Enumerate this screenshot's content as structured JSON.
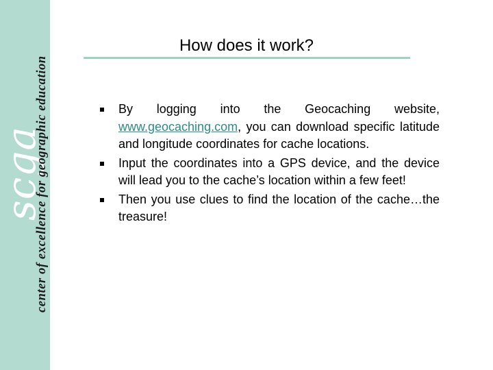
{
  "sidebar": {
    "logo": "scga",
    "tagline": "center of excellence for geographic education",
    "background_color": "#b4dbd0"
  },
  "slide": {
    "title": "How does it work?",
    "rule_color": "#99d6bb",
    "bullets": [
      {
        "before_link": "By logging into the Geocaching website, ",
        "link": "www.geocaching.com",
        "after_link": ", you can download specific latitude and longitude coordinates for cache locations."
      },
      {
        "text": "Input the coordinates into a GPS device, and the device will lead you to the cache’s location within a few feet!"
      },
      {
        "text": "Then you use clues to find the location of the cache…the treasure!"
      }
    ],
    "link_color": "#2a8c8a"
  }
}
